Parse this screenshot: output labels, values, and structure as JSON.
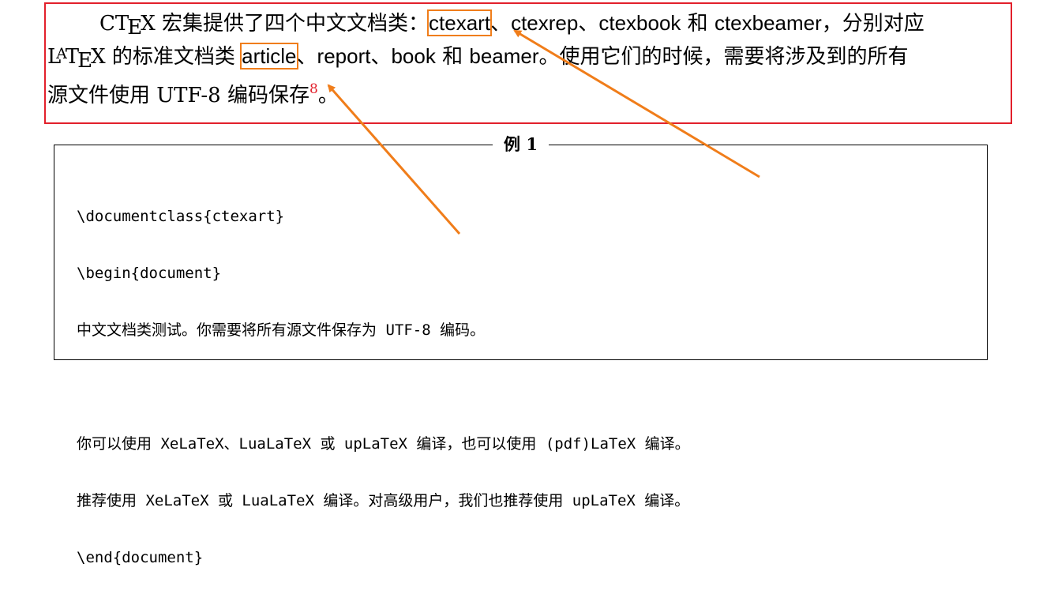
{
  "paragraph": {
    "ctex_c": "C",
    "ctex_t": "T",
    "ctex_e": "E",
    "ctex_x": "X",
    "l1_text": " 宏集提供了四个中文文档类：",
    "l1_ctexart": "ctexart",
    "l1_sep1": "、",
    "l1_ctexrep": "ctexrep",
    "l1_sep2": "、",
    "l1_ctexbook": "ctexbook",
    "l1_he": " 和 ",
    "l1_ctexbeamer": "ctexbeamer",
    "l1_tail": "，分别对应",
    "latex_l": "L",
    "latex_a": "A",
    "latex_t": "T",
    "latex_e": "E",
    "latex_x": "X",
    "l2_text": " 的标准文档类 ",
    "l2_article": "article",
    "l2_sep1": "、",
    "l2_report": "report",
    "l2_sep2": "、",
    "l2_book": "book",
    "l2_he": " 和 ",
    "l2_beamer": "beamer",
    "l2_tail": "。使用它们的时候，需要将涉及到的所有",
    "l3_text": "源文件使用 UTF-8 编码保存",
    "l3_fn": "8",
    "l3_end": "。"
  },
  "example": {
    "title": "例 1",
    "lines": [
      "\\documentclass{ctexart}",
      "\\begin{document}",
      "中文文档类测试。你需要将所有源文件保存为 UTF-8 编码。",
      "",
      "你可以使用 XeLaTeX、LuaLaTeX 或 upLaTeX 编译，也可以使用 (pdf)LaTeX 编译。",
      "推荐使用 XeLaTeX 或 LuaLaTeX 编译。对高级用户，我们也推荐使用 upLaTeX 编译。",
      "\\end{document}"
    ]
  },
  "colors": {
    "frame": "#e2202b",
    "highlight": "#f07d1a",
    "footnote": "#e2202b"
  }
}
